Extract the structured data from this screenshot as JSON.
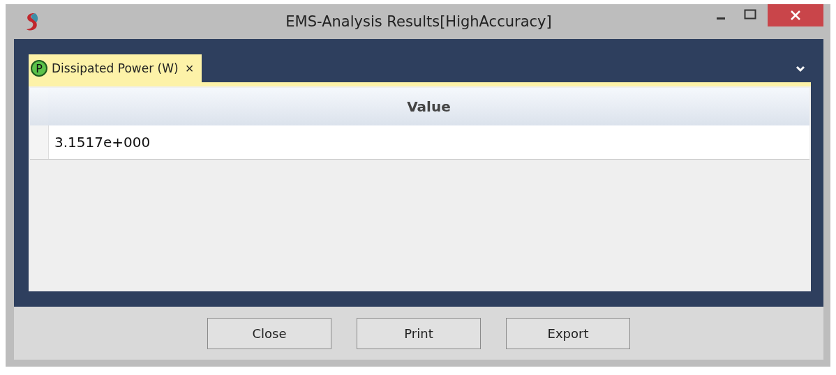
{
  "window": {
    "title": "EMS-Analysis Results[HighAccuracy]"
  },
  "tabs": [
    {
      "badge": "P",
      "label": "Dissipated Power (W)",
      "close": "×",
      "selected": true
    }
  ],
  "table": {
    "columns": [
      "Value"
    ],
    "rows": [
      [
        "3.1517e+000"
      ]
    ]
  },
  "buttons": [
    "Close",
    "Print",
    "Export"
  ]
}
